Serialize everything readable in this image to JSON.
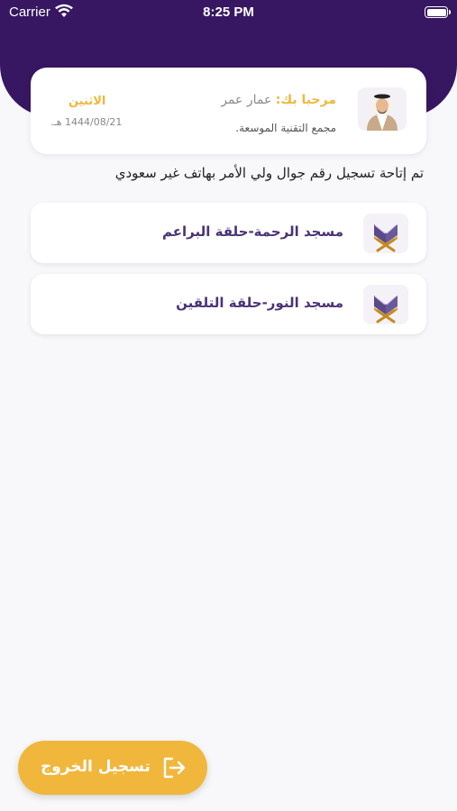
{
  "status_bar": {
    "carrier": "Carrier",
    "time": "8:25 PM"
  },
  "profile": {
    "greeting_prefix": "مرحبا بك:",
    "name": "عمار عمر",
    "organization": "مجمع التقنية الموسعة.",
    "day": "الاثنين",
    "hijri_date": "1444/08/21 هـ."
  },
  "notice": "تم إتاحة تسجيل رقم جوال ولي الأمر بهاتف غير سعودي",
  "halaqat": [
    {
      "label": "مسجد الرحمة-حلقة البراعم",
      "icon": "quran-stand-icon"
    },
    {
      "label": "مسجد النور-حلقة التلقين",
      "icon": "quran-stand-icon"
    }
  ],
  "logout": {
    "label": "تسجيل الخروج",
    "icon": "logout-icon"
  },
  "colors": {
    "header": "#371761",
    "accent": "#f0b73c",
    "card_title": "#4b3377",
    "background": "#f8f8fa"
  }
}
